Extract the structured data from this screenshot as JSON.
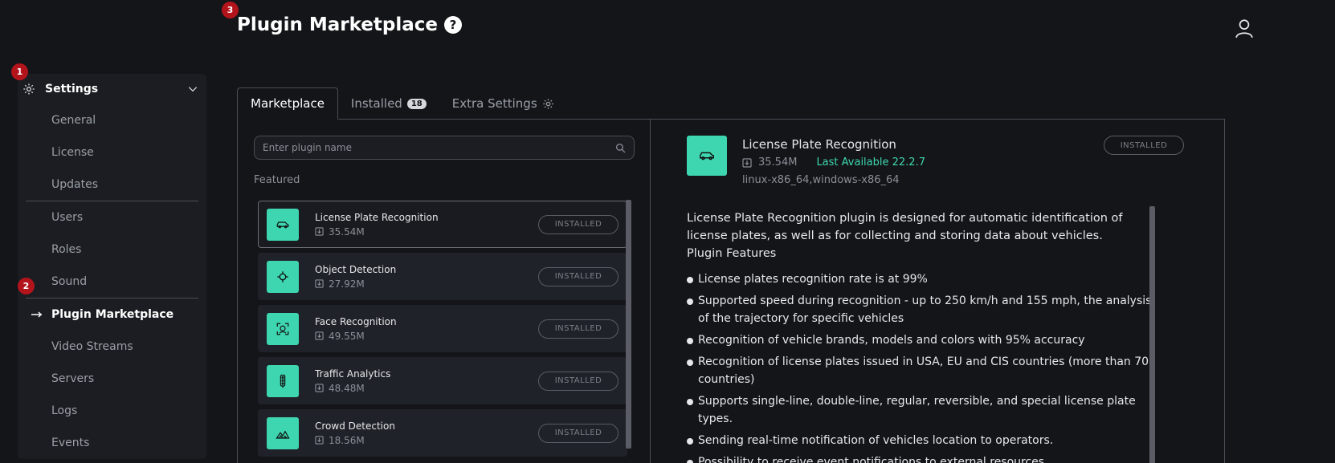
{
  "header": {
    "title": "Plugin Marketplace",
    "help_glyph": "?"
  },
  "markers": [
    "1",
    "2",
    "3"
  ],
  "sidebar": {
    "title": "Settings",
    "items": [
      {
        "label": "General"
      },
      {
        "label": "License"
      },
      {
        "label": "Updates"
      },
      {
        "label": "Users"
      },
      {
        "label": "Roles"
      },
      {
        "label": "Sound"
      },
      {
        "label": "Plugin Marketplace"
      },
      {
        "label": "Video Streams"
      },
      {
        "label": "Servers"
      },
      {
        "label": "Logs"
      },
      {
        "label": "Events"
      }
    ]
  },
  "tabs": {
    "marketplace": "Marketplace",
    "installed": "Installed",
    "installed_count": "18",
    "extra": "Extra Settings"
  },
  "search": {
    "placeholder": "Enter plugin name"
  },
  "featured_label": "Featured",
  "plugins": [
    {
      "name": "License Plate Recognition",
      "size": "35.54M",
      "status": "INSTALLED",
      "icon": "car-icon"
    },
    {
      "name": "Object Detection",
      "size": "27.92M",
      "status": "INSTALLED",
      "icon": "crosshair-icon"
    },
    {
      "name": "Face Recognition",
      "size": "49.55M",
      "status": "INSTALLED",
      "icon": "face-scan-icon"
    },
    {
      "name": "Traffic Analytics",
      "size": "48.48M",
      "status": "INSTALLED",
      "icon": "traffic-light-icon"
    },
    {
      "name": "Crowd Detection",
      "size": "18.56M",
      "status": "INSTALLED",
      "icon": "crowd-icon"
    }
  ],
  "detail": {
    "name": "License Plate Recognition",
    "size": "35.54M",
    "last_available": "Last Available 22.2.7",
    "platforms": "linux-x86_64,windows-x86_64",
    "status": "INSTALLED",
    "description": "License Plate Recognition plugin is designed for automatic identification of license plates, as well as for collecting and storing data about vehicles.",
    "features_title": "Plugin Features",
    "features": [
      "License plates recognition rate is at 99%",
      "Supported speed during recognition - up to 250 km/h and 155 mph, the analysis of the trajectory for specific vehicles",
      "Recognition of vehicle brands, models and colors with 95% accuracy",
      "Recognition of license plates issued in USA, EU and CIS countries (more than 70 countries)",
      "Supports single-line, double-line, regular, reversible, and special license plate types.",
      "Sending real-time notification of vehicles location to operators.",
      "Possibility to receive event notifications to external resources"
    ]
  },
  "colors": {
    "accent": "#3ed6b0",
    "marker": "#b3141c",
    "background": "#141519"
  }
}
